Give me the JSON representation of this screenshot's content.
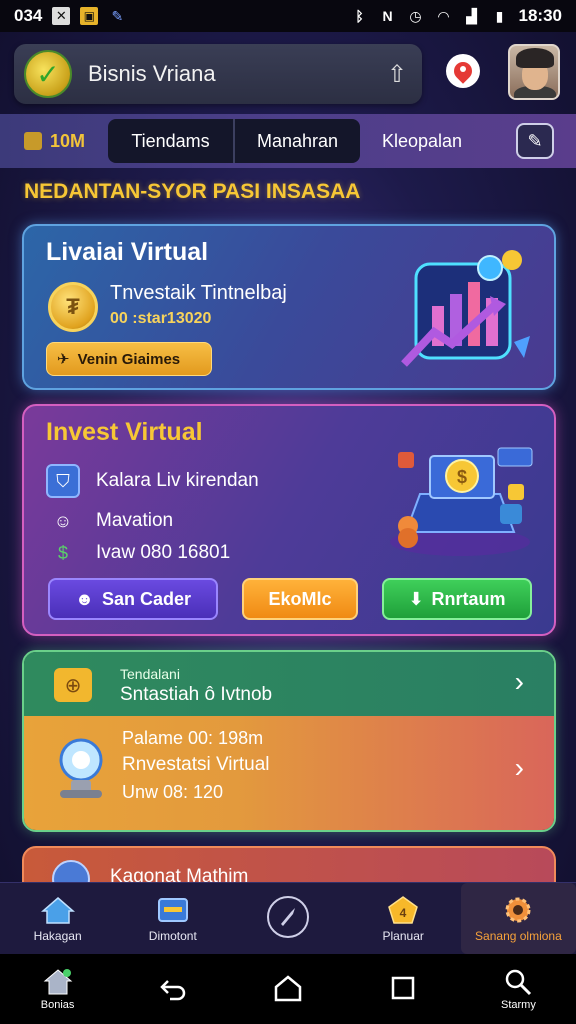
{
  "status_bar": {
    "time_left": "034",
    "time_right": "18:30",
    "icons_left": [
      "close-box-icon",
      "notification-icon",
      "pen-icon"
    ],
    "icons_right": [
      "bluetooth-icon",
      "nfc-icon",
      "alarm-icon",
      "wifi-icon",
      "signal-icon",
      "battery-icon"
    ]
  },
  "header": {
    "app_title": "Bisnis Vriana",
    "share_icon": "share-icon",
    "location_icon": "location-pin-icon",
    "avatar_icon": "user-avatar"
  },
  "tabbar": {
    "coins": "10M",
    "tabs": [
      "Tiendams",
      "Manahran"
    ],
    "extra_tab": "Kleopalan",
    "edit_icon": "edit-icon"
  },
  "section_title": "NEDANTAN-SYOR PASI INSASAA",
  "card1": {
    "title": "Livaiai Virtual",
    "line1": "Tnvestaik Tintnelbaj",
    "line2": "00 :star13020",
    "button": "Venin Giaimes"
  },
  "card2": {
    "title": "Invest Virtual",
    "rows": [
      "Kalara Liv kirendan",
      "Mavation",
      "Ivaw 080 16801"
    ],
    "buttons": [
      "San Cader",
      "EkoMlc",
      "Rnrtaum"
    ]
  },
  "card3": {
    "small": "Tendalani",
    "line": "Sntastiah ô Ivtnob",
    "b1": "Palame 00: 198m",
    "b2": "Rnvestatsi Virtual",
    "b3": "Unw 08: 120"
  },
  "card4": {
    "title": "Kagonat Mathim"
  },
  "app_nav": [
    {
      "label": "Hakagan",
      "icon": "home-icon"
    },
    {
      "label": "Dimotont",
      "icon": "card-icon"
    },
    {
      "label": "",
      "icon": "compass-icon"
    },
    {
      "label": "Planuar",
      "icon": "badge-icon"
    },
    {
      "label": "Sanang olmiona",
      "icon": "gear-icon"
    }
  ],
  "sys_nav": [
    {
      "label": "Bonias",
      "icon": "home-icon"
    },
    {
      "label": "",
      "icon": "back-icon"
    },
    {
      "label": "",
      "icon": "home-outline-icon"
    },
    {
      "label": "",
      "icon": "recents-icon"
    },
    {
      "label": "Starmy",
      "icon": "search-icon"
    }
  ],
  "colors": {
    "accent_gold": "#f7c735",
    "card1_border": "#5fa3e0",
    "card2_border": "#d45fc0",
    "card3_border": "#6ad08a",
    "active_nav": "#f7a23a"
  }
}
